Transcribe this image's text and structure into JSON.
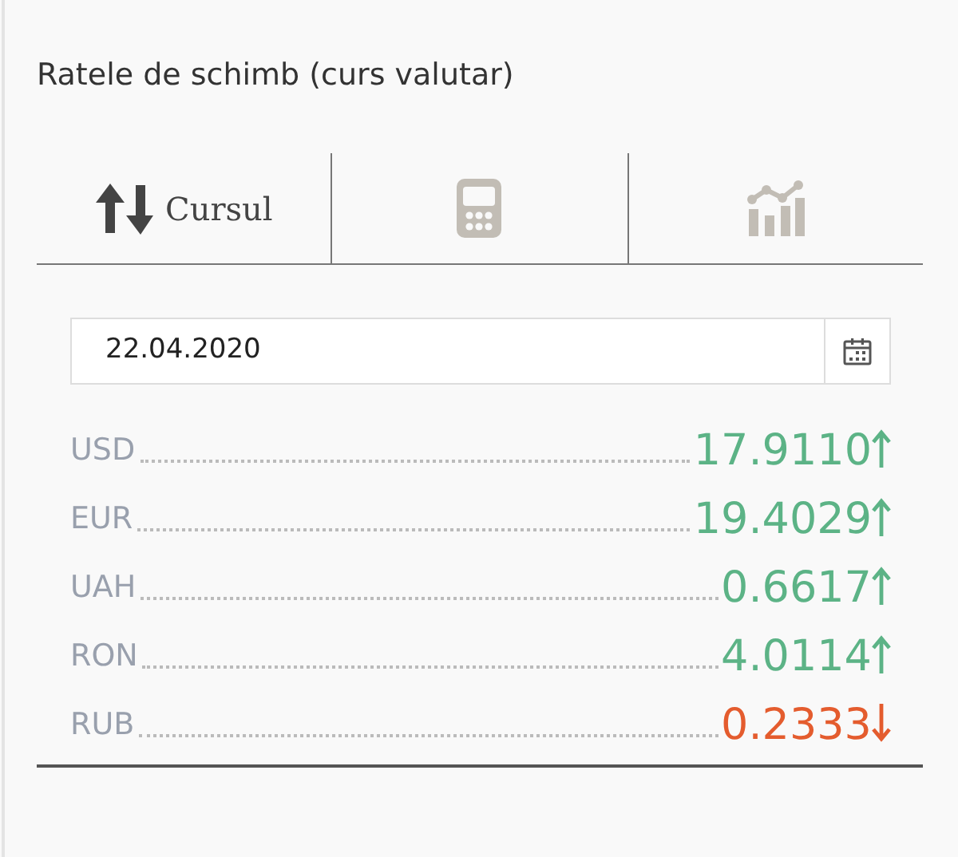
{
  "title": "Ratele de schimb (curs valutar)",
  "tabs": [
    {
      "kind": "rates",
      "label": "Cursul",
      "selected": true
    },
    {
      "kind": "converter",
      "selected": false
    },
    {
      "kind": "chart",
      "selected": false
    }
  ],
  "date_field": {
    "value": "22.04.2020"
  },
  "rates": [
    {
      "currency": "USD",
      "value": "17.9110",
      "rising": true
    },
    {
      "currency": "EUR",
      "value": "19.4029",
      "rising": true
    },
    {
      "currency": "UAH",
      "value": "0.6617",
      "rising": true
    },
    {
      "currency": "RON",
      "value": "4.0114",
      "rising": true
    },
    {
      "currency": "RUB",
      "value": "0.2333",
      "rising": false
    }
  ]
}
